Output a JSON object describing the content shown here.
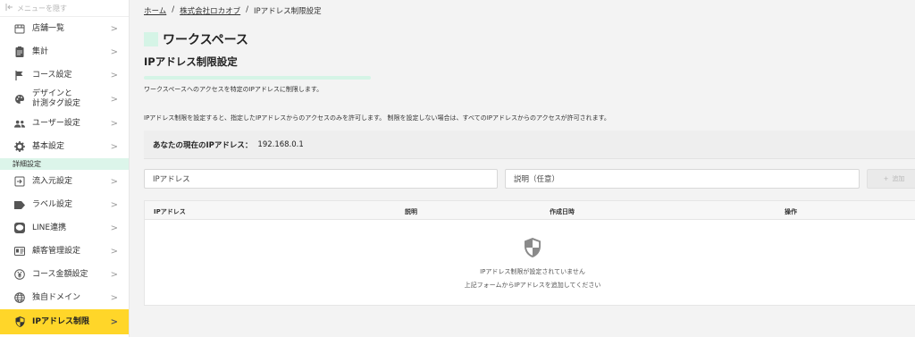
{
  "sidebar": {
    "hide_menu": "メニューを隠す",
    "items": [
      {
        "label": "店舗一覧",
        "icon": "store-icon"
      },
      {
        "label": "集計",
        "icon": "clipboard-icon"
      },
      {
        "label": "コース設定",
        "icon": "flag-icon"
      },
      {
        "label_line1": "デザインと",
        "label_line2": "計測タグ設定",
        "icon": "palette-icon"
      },
      {
        "label": "ユーザー設定",
        "icon": "users-icon"
      },
      {
        "label": "基本設定",
        "icon": "gear-icon"
      }
    ],
    "section_label": "詳細設定",
    "detail_items": [
      {
        "label": "流入元設定",
        "icon": "login-icon"
      },
      {
        "label": "ラベル設定",
        "icon": "label-icon"
      },
      {
        "label": "LINE連携",
        "icon": "line-icon"
      },
      {
        "label": "顧客管理設定",
        "icon": "id-card-icon"
      },
      {
        "label": "コース金額設定",
        "icon": "yen-icon"
      },
      {
        "label": "独自ドメイン",
        "icon": "globe-icon"
      },
      {
        "label": "IPアドレス制限",
        "icon": "shield-icon",
        "active": true
      }
    ],
    "chevron": ">",
    "active_color": "#ffd629",
    "section_color": "#dcf5ea"
  },
  "breadcrumb": {
    "home": "ホーム",
    "company": "株式会社ロカオブ",
    "current": "IPアドレス制限設定",
    "sep": "/"
  },
  "workspace_title": "ワークスペース",
  "page_title": "IPアドレス制限設定",
  "description": "ワークスペースへのアクセスを特定のIPアドレスに制限します。",
  "note": "IPアドレス制限を設定すると、指定したIPアドレスからのアクセスのみを許可します。 制限を設定しない場合は、すべてのIPアドレスからのアクセスが許可されます。",
  "current_ip": {
    "label": "あなたの現在のIPアドレス：",
    "value": "192.168.0.1"
  },
  "form": {
    "ip_placeholder": "IPアドレス",
    "desc_placeholder": "説明（任意）",
    "add_label": "追加",
    "add_icon": "+"
  },
  "table": {
    "columns": [
      "IPアドレス",
      "説明",
      "作成日時",
      "操作"
    ],
    "empty_line1": "IPアドレス制限が設定されていません",
    "empty_line2": "上記フォームからIPアドレスを追加してください"
  }
}
